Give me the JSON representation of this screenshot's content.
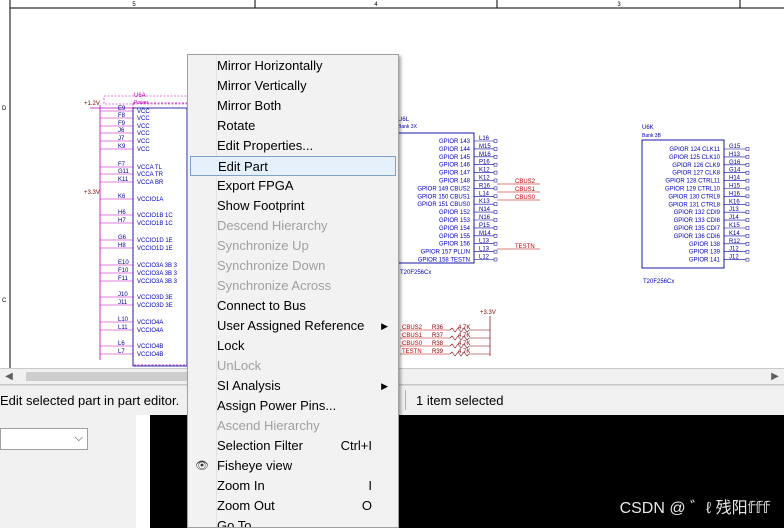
{
  "schematic": {
    "zone_labels": [
      "5",
      "4",
      "3"
    ],
    "left_part": {
      "ref": "U6A",
      "value": "Power",
      "nets": [
        "+1.2V",
        "+3.3V"
      ],
      "pins": [
        {
          "num": "E9",
          "name": "VCC"
        },
        {
          "num": "F8",
          "name": "VCC"
        },
        {
          "num": "F9",
          "name": "VCC"
        },
        {
          "num": "J6",
          "name": "VCC"
        },
        {
          "num": "J7",
          "name": "VCC"
        },
        {
          "num": "K9",
          "name": "VCC"
        },
        {
          "num": "F7",
          "name": "VCCA_TL"
        },
        {
          "num": "G11",
          "name": "VCCA_TR"
        },
        {
          "num": "K11",
          "name": "VCCA_BR"
        },
        {
          "num": "K6",
          "name": "VCCIO1A"
        },
        {
          "num": "H6",
          "name": "VCCIO1B_1C"
        },
        {
          "num": "H7",
          "name": "VCCIO1B_1C"
        },
        {
          "num": "G6",
          "name": "VCCIO1D_1E"
        },
        {
          "num": "H8",
          "name": "VCCIO1D_1E"
        },
        {
          "num": "E10",
          "name": "VCCIO3A_3B_3"
        },
        {
          "num": "F10",
          "name": "VCCIO3A_3B_3"
        },
        {
          "num": "F11",
          "name": "VCCIO3A_3B_3"
        },
        {
          "num": "J10",
          "name": "VCCIO3D_3E"
        },
        {
          "num": "J11",
          "name": "VCCIO3D_3E"
        },
        {
          "num": "L10",
          "name": "VCCIO4A"
        },
        {
          "num": "L11",
          "name": "VCCIO4A"
        },
        {
          "num": "L6",
          "name": "VCCIO4B"
        },
        {
          "num": "L7",
          "name": "VCCIO4B"
        }
      ]
    },
    "mid_part": {
      "ref": "U6L",
      "bank": "Bank_3X",
      "footer": "T20F256Cx",
      "pins": [
        {
          "name": "GPIOR_143",
          "num": "L16"
        },
        {
          "name": "GPIOR_144",
          "num": "M15"
        },
        {
          "name": "GPIOR_145",
          "num": "M16"
        },
        {
          "name": "GPIOR_146",
          "num": "P16"
        },
        {
          "name": "GPIOR_147",
          "num": "K12"
        },
        {
          "name": "GPIOR_148",
          "num": "K12"
        },
        {
          "name": "GPIOR_149_CBUS2",
          "num": "R16"
        },
        {
          "name": "GPIOR_150_CBUS1",
          "num": "L14"
        },
        {
          "name": "GPIOR_151_CBUS0",
          "num": "K13"
        },
        {
          "name": "GPIOR_152",
          "num": "N14"
        },
        {
          "name": "GPIOR_153",
          "num": "N16"
        },
        {
          "name": "GPIOR_154",
          "num": "P15"
        },
        {
          "name": "GPIOR_155",
          "num": "M14"
        },
        {
          "name": "GPIOR_156",
          "num": "L13"
        },
        {
          "name": "GPIOR_157_PLLIN",
          "num": "L13"
        },
        {
          "name": "GPIOR_158_TESTN",
          "num": "L12"
        }
      ],
      "nets": [
        "CBUS2",
        "CBUS1",
        "CBUS0",
        "TESTN"
      ]
    },
    "right_part": {
      "ref": "U6K",
      "bank": "Bank_3B",
      "footer": "T20F256Cx",
      "pins": [
        {
          "name": "GPIOR_124_CLK11",
          "num": "G15"
        },
        {
          "name": "GPIOR_125_CLK10",
          "num": "H13"
        },
        {
          "name": "GPIOR_126_CLK9",
          "num": "G16"
        },
        {
          "name": "GPIOR_127_CLK8",
          "num": "G14"
        },
        {
          "name": "GPIOR_128_CTRL11",
          "num": "H14"
        },
        {
          "name": "GPIOR_129_CTRL10",
          "num": "H15"
        },
        {
          "name": "GPIOR_130_CTRL9",
          "num": "H16"
        },
        {
          "name": "GPIOR_131_CTRL8",
          "num": "K16"
        },
        {
          "name": "GPIOR_132_CDI9",
          "num": "J13"
        },
        {
          "name": "GPIOR_133_CDI8",
          "num": "J14"
        },
        {
          "name": "GPIOR_135_CDI7",
          "num": "K15"
        },
        {
          "name": "GPIOR_136_CDI6",
          "num": "K14"
        },
        {
          "name": "GPIOR_138",
          "num": "R12"
        },
        {
          "name": "GPIOR_139",
          "num": "J12"
        },
        {
          "name": "GPIOR_141",
          "num": "J12"
        }
      ]
    },
    "resistors": [
      {
        "net": "CBUS2",
        "ref": "R36",
        "value": "4.7K"
      },
      {
        "net": "CBUS1",
        "ref": "R37",
        "value": "4.7K"
      },
      {
        "net": "CBUS0",
        "ref": "R38",
        "value": "4.7K"
      },
      {
        "net": "TESTN",
        "ref": "R39",
        "value": "4.7K"
      }
    ],
    "pullup_net": "+3.3V"
  },
  "context_menu": {
    "items": [
      {
        "label": "Mirror Horizontally",
        "enabled": true
      },
      {
        "label": "Mirror Vertically",
        "enabled": true
      },
      {
        "label": "Mirror Both",
        "enabled": true
      },
      {
        "label": "Rotate",
        "enabled": true
      },
      {
        "label": "Edit Properties...",
        "enabled": true
      },
      {
        "label": "Edit Part",
        "enabled": true,
        "highlighted": true
      },
      {
        "label": "Export FPGA",
        "enabled": true
      },
      {
        "label": "Show Footprint",
        "enabled": true
      },
      {
        "label": "Descend Hierarchy",
        "enabled": false
      },
      {
        "label": "Synchronize Up",
        "enabled": false
      },
      {
        "label": "Synchronize Down",
        "enabled": false
      },
      {
        "label": "Synchronize Across",
        "enabled": false
      },
      {
        "label": "Connect to Bus",
        "enabled": true
      },
      {
        "label": "User Assigned Reference",
        "enabled": true,
        "submenu": true
      },
      {
        "label": "Lock",
        "enabled": true
      },
      {
        "label": "UnLock",
        "enabled": false
      },
      {
        "label": "SI Analysis",
        "enabled": true,
        "submenu": true
      },
      {
        "label": "Assign Power Pins...",
        "enabled": true
      },
      {
        "label": "Ascend Hierarchy",
        "enabled": false
      },
      {
        "label": "Selection Filter",
        "enabled": true,
        "shortcut": "Ctrl+I"
      },
      {
        "label": "Fisheye view",
        "enabled": true,
        "checked": true
      },
      {
        "label": "Zoom In",
        "enabled": true,
        "shortcut": "I"
      },
      {
        "label": "Zoom Out",
        "enabled": true,
        "shortcut": "O"
      },
      {
        "label": "Go To",
        "enabled": true
      }
    ]
  },
  "status_bar": {
    "hint": "Edit selected part in part editor.",
    "selection": "1 item selected"
  },
  "watermark": "CSDN @ ゛ℓ 残阳𝕗𝕗𝕗",
  "colors": {
    "part_outline": "#0000a0",
    "part_text": "#0000c0",
    "wire": "#800000",
    "net_label": "#c00000",
    "power_wire": "#c000c0",
    "menu_highlight": "#e5f0fb"
  }
}
